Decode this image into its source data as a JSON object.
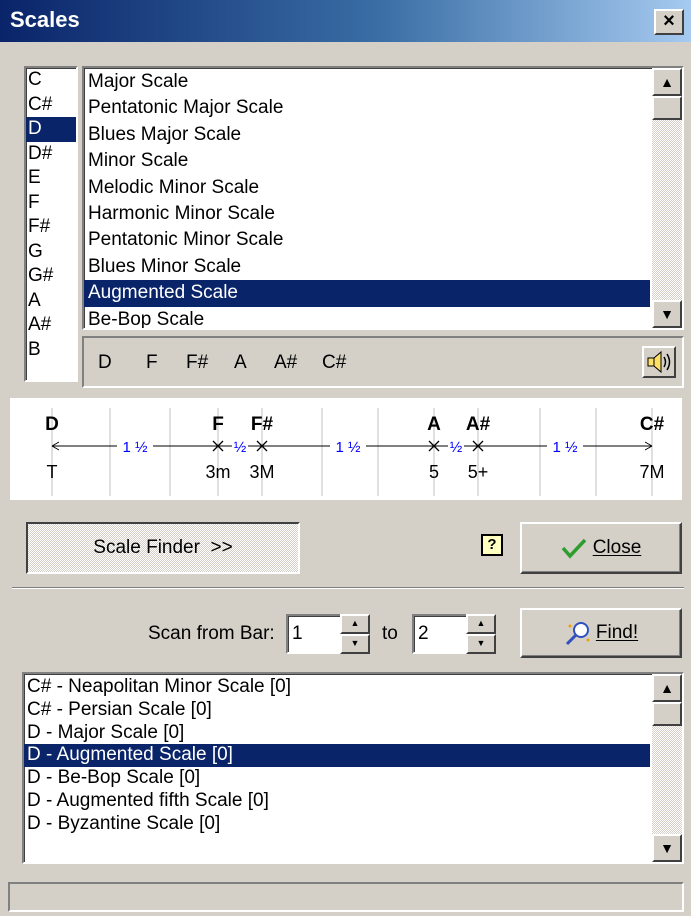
{
  "window": {
    "title": "Scales",
    "close_glyph": "×"
  },
  "roots": {
    "items": [
      "C",
      "C#",
      "D",
      "D#",
      "E",
      "F",
      "F#",
      "G",
      "G#",
      "A",
      "A#",
      "B"
    ],
    "selected": "D"
  },
  "scales": {
    "items": [
      "Major Scale",
      "Pentatonic Major Scale",
      "Blues Major Scale",
      "Minor Scale",
      "Melodic Minor Scale",
      "Harmonic Minor Scale",
      "Pentatonic Minor Scale",
      "Blues Minor Scale",
      "Augmented Scale",
      "Be-Bop Scale"
    ],
    "selected": "Augmented Scale"
  },
  "notes": [
    "D",
    "F",
    "F#",
    "A",
    "A#",
    "C#"
  ],
  "speaker_icon": "speaker-icon",
  "diagram": {
    "notes": [
      {
        "name": "D",
        "degree": "T"
      },
      {
        "name": "F",
        "degree": "3m"
      },
      {
        "name": "F#",
        "degree": "3M"
      },
      {
        "name": "A",
        "degree": "5"
      },
      {
        "name": "A#",
        "degree": "5+"
      },
      {
        "name": "C#",
        "degree": "7M"
      }
    ],
    "intervals": [
      "1 ½",
      "½",
      "1 ½",
      "½",
      "1 ½"
    ],
    "interval_color": "#0000ff"
  },
  "buttons": {
    "scale_finder": "Scale Finder  >>",
    "close": "Close",
    "find": "Find!",
    "help_glyph": "?"
  },
  "scan": {
    "from_label": "Scan from Bar:",
    "from_value": "1",
    "to_label": "to",
    "to_value": "2"
  },
  "results": {
    "items": [
      "C# - Neapolitan Minor Scale [0]",
      "C# - Persian Scale [0]",
      "D - Major Scale [0]",
      "D - Augmented Scale [0]",
      "D - Be-Bop Scale [0]",
      "D - Augmented fifth Scale [0]",
      "D - Byzantine Scale [0]"
    ],
    "selected": "D - Augmented Scale [0]"
  },
  "colors": {
    "selection": "#0a246a",
    "title_start": "#0a246a",
    "title_end": "#a6caf0",
    "check": "#2e9d2e"
  }
}
